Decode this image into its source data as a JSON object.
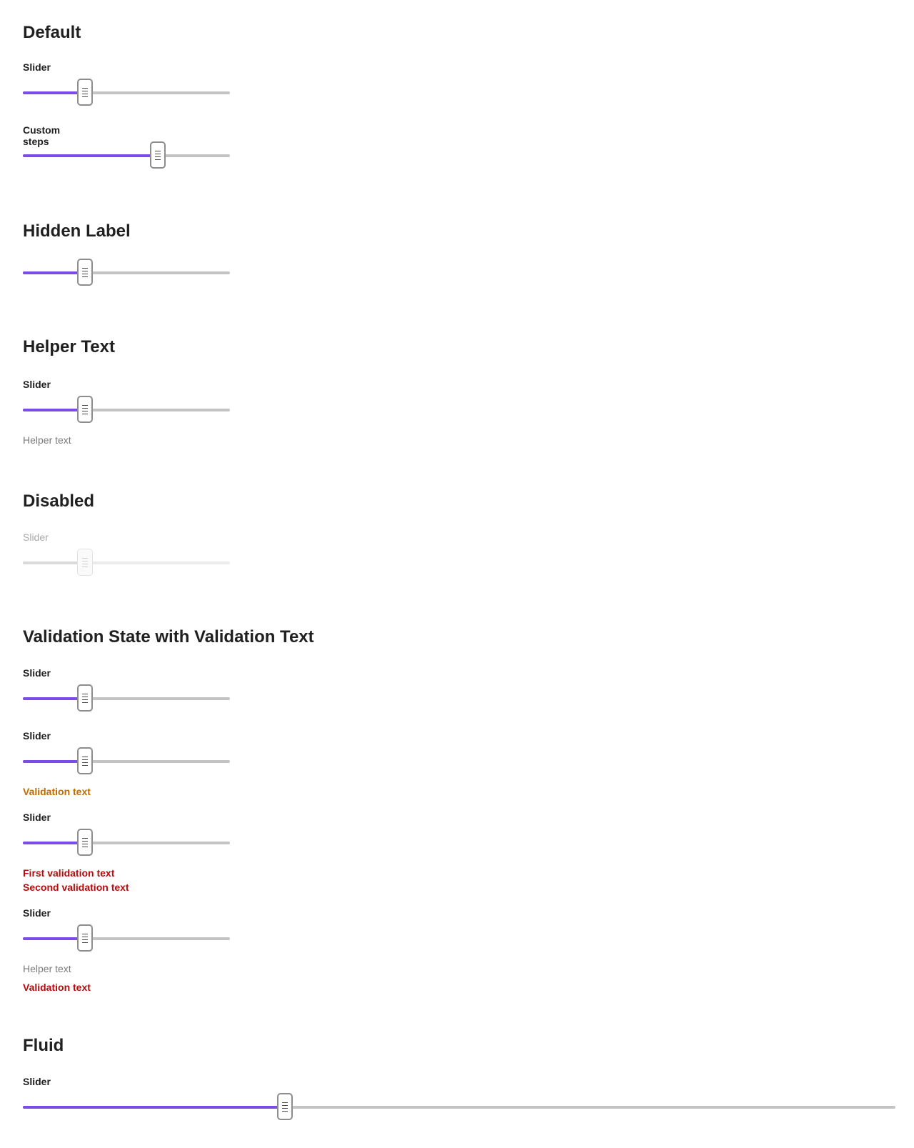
{
  "sections": {
    "default": {
      "title": "Default",
      "slider_label": "Slider",
      "slider_value": 0.3,
      "custom_label": "Custom steps",
      "custom_value": 0.65
    },
    "hidden_label": {
      "title": "Hidden Label",
      "slider_value": 0.3
    },
    "helper_text": {
      "title": "Helper Text",
      "slider_label": "Slider",
      "slider_value": 0.3,
      "helper": "Helper text"
    },
    "disabled": {
      "title": "Disabled",
      "slider_label": "Slider",
      "slider_value": 0.3
    },
    "validation": {
      "title": "Validation State with Validation Text",
      "s1_label": "Slider",
      "s1_value": 0.3,
      "s2_label": "Slider",
      "s2_value": 0.3,
      "s2_validation": "Validation text",
      "s3_label": "Slider",
      "s3_value": 0.3,
      "s3_validation_1": "First validation text",
      "s3_validation_2": "Second validation text",
      "s4_label": "Slider",
      "s4_value": 0.3,
      "s4_helper": "Helper text",
      "s4_validation": "Validation text"
    },
    "fluid": {
      "title": "Fluid",
      "slider_label": "Slider",
      "slider_value": 0.3
    }
  },
  "colors": {
    "accent": "#7b4ce8",
    "track": "#c4c4c4",
    "warning": "#c06a00",
    "error": "#b40c0c",
    "helper": "#7a7a7a"
  }
}
